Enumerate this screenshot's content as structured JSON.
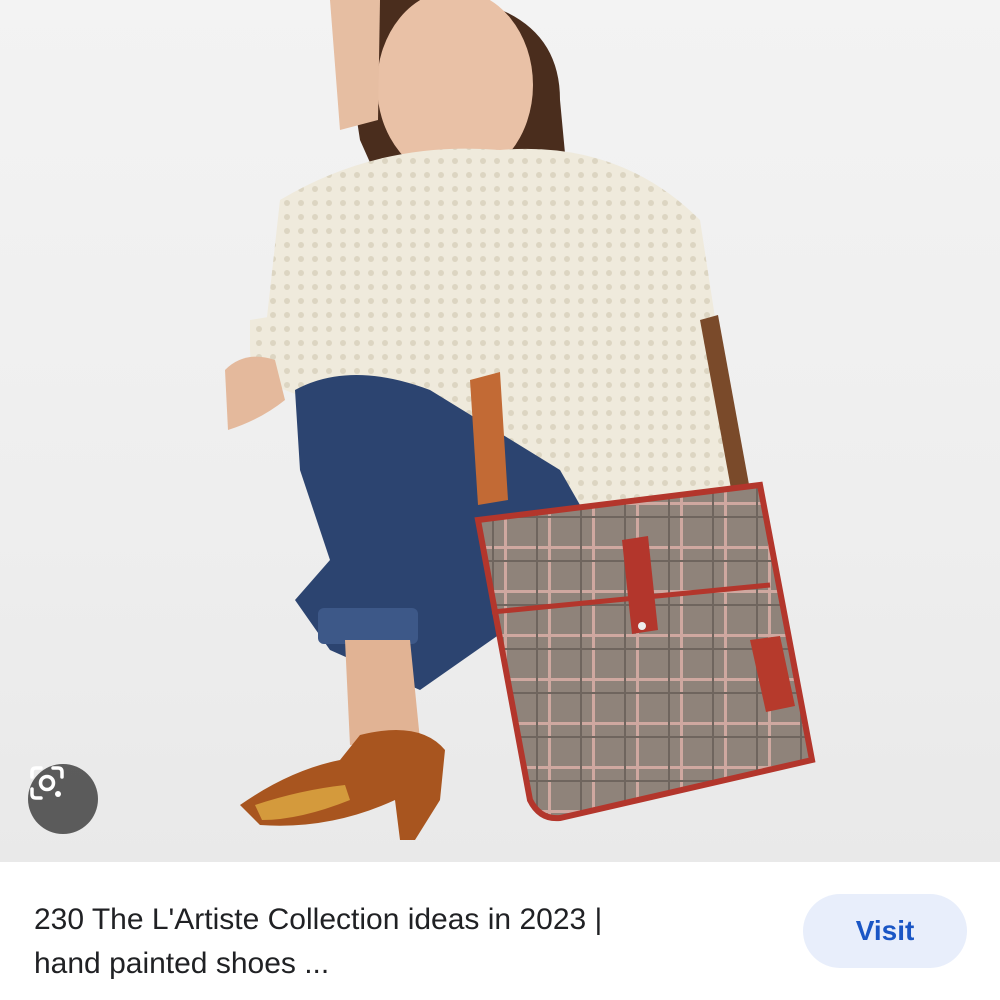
{
  "result": {
    "title_line1": "230 The L'Artiste Collection ideas in 2023 |",
    "title_line2": "hand painted shoes ...",
    "visit_label": "Visit"
  },
  "icons": {
    "lens": "google-lens-icon"
  },
  "colors": {
    "visit_bg": "#e8eefb",
    "visit_text": "#1a56c5",
    "lens_bg": "#3c3c3c"
  }
}
